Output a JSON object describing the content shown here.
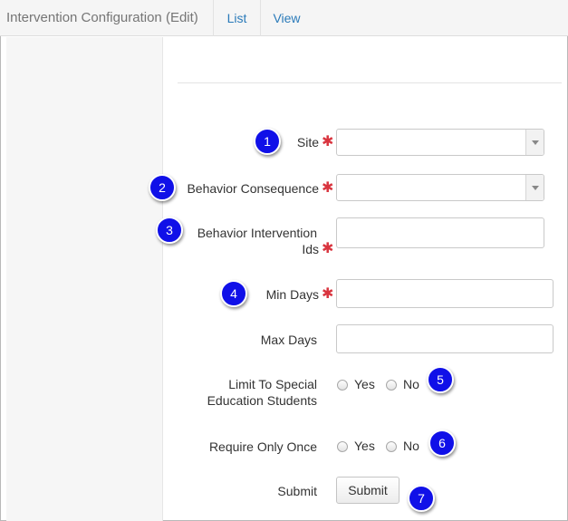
{
  "header": {
    "title": "Intervention Configuration (Edit)",
    "tabs": [
      {
        "label": "List"
      },
      {
        "label": "View"
      }
    ]
  },
  "form": {
    "required_mark": "✱",
    "site": {
      "label": "Site",
      "value": ""
    },
    "behavior_consequence": {
      "label": "Behavior Consequence",
      "value": ""
    },
    "behavior_intervention_ids": {
      "label_line1": "Behavior Intervention",
      "label_line2": "Ids",
      "value": ""
    },
    "min_days": {
      "label": "Min Days",
      "value": ""
    },
    "max_days": {
      "label": "Max Days",
      "value": ""
    },
    "limit_special_ed": {
      "label_line1": "Limit To Special",
      "label_line2": "Education Students",
      "options": [
        "Yes",
        "No"
      ]
    },
    "require_only_once": {
      "label": "Require Only Once",
      "options": [
        "Yes",
        "No"
      ]
    },
    "submit": {
      "label": "Submit",
      "button_label": "Submit"
    }
  },
  "markers": [
    "1",
    "2",
    "3",
    "4",
    "5",
    "6",
    "7"
  ],
  "colors": {
    "accent_link": "#2a7ab9",
    "required": "#d9353f",
    "marker": "#1010e8"
  }
}
